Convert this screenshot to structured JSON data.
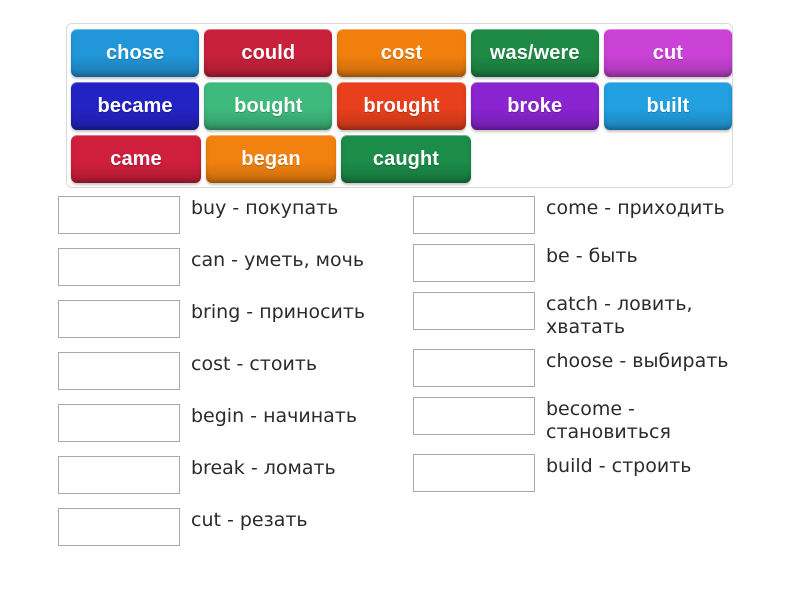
{
  "word_bank": {
    "rows": [
      [
        {
          "label": "chose",
          "color": "#2196d9"
        },
        {
          "label": "could",
          "color": "#c9213b"
        },
        {
          "label": "cost",
          "color": "#f2800d"
        },
        {
          "label": "was/were",
          "color": "#1f8a46"
        },
        {
          "label": "cut",
          "color": "#cb42d6"
        }
      ],
      [
        {
          "label": "became",
          "color": "#2323c4"
        },
        {
          "label": "bought",
          "color": "#3fba7d"
        },
        {
          "label": "brought",
          "color": "#e8401c"
        },
        {
          "label": "broke",
          "color": "#8a24d1"
        },
        {
          "label": "built",
          "color": "#22a0e0"
        }
      ],
      [
        {
          "label": "came",
          "color": "#d01f3c"
        },
        {
          "label": "began",
          "color": "#f2820f"
        },
        {
          "label": "caught",
          "color": "#1b8c49"
        }
      ]
    ]
  },
  "left_column": [
    {
      "text": "buy - покупать",
      "answer": ""
    },
    {
      "text": "can - уметь, мочь",
      "answer": ""
    },
    {
      "text": "bring - приносить",
      "answer": ""
    },
    {
      "text": "cost - стоить",
      "answer": ""
    },
    {
      "text": "begin - начинать",
      "answer": ""
    },
    {
      "text": "break - ломать",
      "answer": ""
    },
    {
      "text": "cut - резать",
      "answer": ""
    }
  ],
  "right_column": [
    {
      "text": "come - приходить",
      "answer": ""
    },
    {
      "text": "be - быть",
      "answer": ""
    },
    {
      "text": "catch - ловить, хватать",
      "answer": ""
    },
    {
      "text": "choose - выбирать",
      "answer": ""
    },
    {
      "text": "become - становиться",
      "answer": ""
    },
    {
      "text": "build - строить",
      "answer": ""
    }
  ]
}
